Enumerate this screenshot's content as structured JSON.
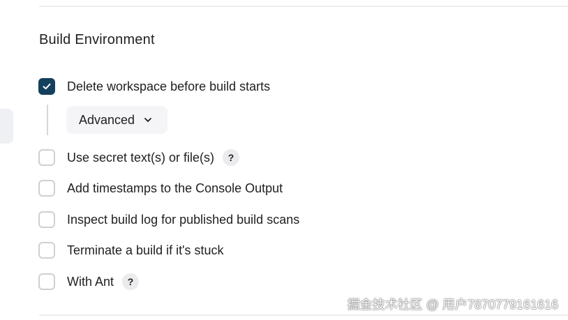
{
  "section": {
    "title": "Build Environment"
  },
  "options": [
    {
      "label": "Delete workspace before build starts",
      "checked": true,
      "help": false
    },
    {
      "label": "Use secret text(s) or file(s)",
      "checked": false,
      "help": true
    },
    {
      "label": "Add timestamps to the Console Output",
      "checked": false,
      "help": false
    },
    {
      "label": "Inspect build log for published build scans",
      "checked": false,
      "help": false
    },
    {
      "label": "Terminate a build if it's stuck",
      "checked": false,
      "help": false
    },
    {
      "label": "With Ant",
      "checked": false,
      "help": true
    }
  ],
  "advanced": {
    "label": "Advanced",
    "icon": "chevron-down-icon"
  },
  "help_label": "?",
  "watermark": "掘金技术社区 @ 用户7870779161616",
  "colors": {
    "checkbox_checked": "#14405e",
    "checkbox_border": "#d0d0d4",
    "help_bg": "#ebebee",
    "advanced_bg": "#f5f5f7"
  }
}
